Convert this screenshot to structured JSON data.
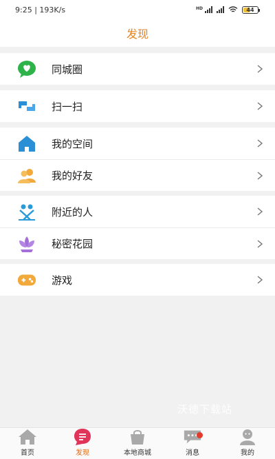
{
  "status": {
    "time": "9:25",
    "speed": "193K/s",
    "battery": "44",
    "battery_level": 0.44
  },
  "header": {
    "title": "发现"
  },
  "groups": [
    {
      "items": [
        {
          "label": "同城圈",
          "icon": "chat-heart-icon",
          "color": "#2db34a"
        }
      ]
    },
    {
      "items": [
        {
          "label": "扫一扫",
          "icon": "scan-icon",
          "color": "#2b8fd6"
        }
      ]
    },
    {
      "items": [
        {
          "label": "我的空间",
          "icon": "house-icon",
          "color": "#2b8fd6"
        },
        {
          "label": "我的好友",
          "icon": "friends-icon",
          "color": "#f2a93b"
        }
      ]
    },
    {
      "items": [
        {
          "label": "附近的人",
          "icon": "nearby-people-icon",
          "color": "#2b9ad9"
        },
        {
          "label": "秘密花园",
          "icon": "lotus-icon",
          "color": "#a46fd9"
        }
      ]
    },
    {
      "items": [
        {
          "label": "游戏",
          "icon": "gamepad-icon",
          "color": "#f2a93b"
        }
      ]
    }
  ],
  "watermark": "沃德下载站",
  "tabs": [
    {
      "label": "首页",
      "icon": "home-icon",
      "active": false
    },
    {
      "label": "发现",
      "icon": "discover-icon",
      "active": true
    },
    {
      "label": "本地商城",
      "icon": "shopping-bag-icon",
      "active": false
    },
    {
      "label": "消息",
      "icon": "message-icon",
      "active": false,
      "badge": true
    },
    {
      "label": "我的",
      "icon": "profile-icon",
      "active": false
    }
  ],
  "colors": {
    "accent": "#e6831e",
    "active_tab": "#e06a1a",
    "badge": "#e23b2e"
  }
}
